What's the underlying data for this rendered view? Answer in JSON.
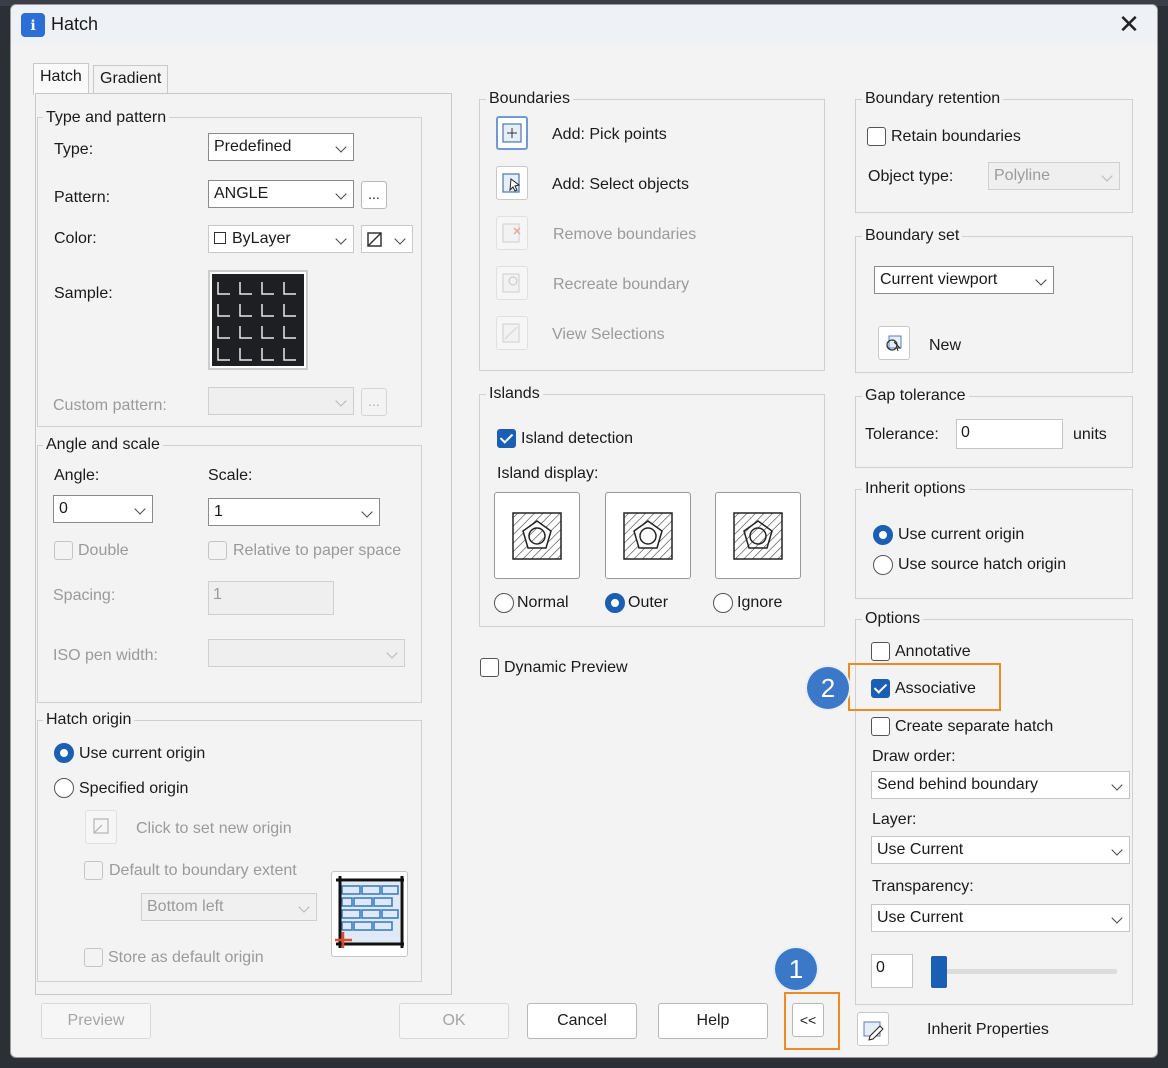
{
  "dialog": {
    "title": "Hatch",
    "close_glyph": "✕"
  },
  "tabs": [
    {
      "label": "Hatch"
    },
    {
      "label": "Gradient"
    }
  ],
  "type_pattern": {
    "title": "Type and pattern",
    "type_label": "Type:",
    "type_value": "Predefined",
    "pattern_label": "Pattern:",
    "pattern_value": "ANGLE",
    "pattern_browse": "...",
    "color_label": "Color:",
    "color_value": "ByLayer",
    "sample_label": "Sample:",
    "custom_pattern_label": "Custom pattern:",
    "custom_browse": "..."
  },
  "angle_scale": {
    "title": "Angle and scale",
    "angle_label": "Angle:",
    "angle_value": "0",
    "scale_label": "Scale:",
    "scale_value": "1",
    "double_label": "Double",
    "relative_label": "Relative to paper space",
    "spacing_label": "Spacing:",
    "spacing_value": "1",
    "iso_label": "ISO pen width:"
  },
  "hatch_origin": {
    "title": "Hatch origin",
    "use_current": "Use current origin",
    "specified": "Specified origin",
    "click_set": "Click to set new origin",
    "default_extent": "Default to boundary extent",
    "position_value": "Bottom left",
    "store_default": "Store as default origin"
  },
  "boundaries": {
    "title": "Boundaries",
    "items": [
      {
        "label": "Add: Pick points",
        "enabled": true
      },
      {
        "label": "Add: Select objects",
        "enabled": true
      },
      {
        "label": "Remove boundaries",
        "enabled": false
      },
      {
        "label": "Recreate boundary",
        "enabled": false
      },
      {
        "label": "View Selections",
        "enabled": false
      }
    ]
  },
  "islands": {
    "title": "Islands",
    "detection_label": "Island detection",
    "display_label": "Island display:",
    "options": [
      "Normal",
      "Outer",
      "Ignore"
    ],
    "selected": "Outer"
  },
  "dynamic_preview": "Dynamic Preview",
  "boundary_retention": {
    "title": "Boundary retention",
    "retain_label": "Retain boundaries",
    "object_type_label": "Object type:",
    "object_type_value": "Polyline"
  },
  "boundary_set": {
    "title": "Boundary set",
    "value": "Current viewport",
    "new_label": "New"
  },
  "gap_tolerance": {
    "title": "Gap tolerance",
    "tolerance_label": "Tolerance:",
    "tolerance_value": "0",
    "units": "units"
  },
  "inherit_options": {
    "title": "Inherit options",
    "use_current": "Use current origin",
    "use_source": "Use source hatch origin"
  },
  "options": {
    "title": "Options",
    "annotative": "Annotative",
    "associative": "Associative",
    "separate": "Create separate hatch",
    "draw_order_label": "Draw order:",
    "draw_order_value": "Send behind boundary",
    "layer_label": "Layer:",
    "layer_value": "Use Current",
    "transparency_label": "Transparency:",
    "transparency_value": "Use Current",
    "transparency_number": "0",
    "transparency_level": 0
  },
  "footer": {
    "preview": "Preview",
    "ok": "OK",
    "cancel": "Cancel",
    "help": "Help",
    "collapse": "<<",
    "inherit": "Inherit Properties"
  },
  "callouts": {
    "one": "1",
    "two": "2"
  },
  "colors": {
    "accent": "#1a5fb4",
    "highlight": "#f08a24",
    "badge": "#3c78c8"
  }
}
